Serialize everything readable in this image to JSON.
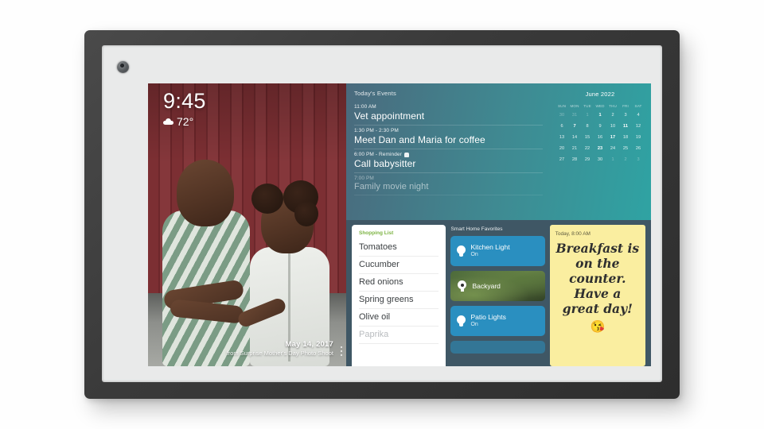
{
  "device": {
    "camera_icon": "camera-lens"
  },
  "photo": {
    "clock": {
      "time": "9:45",
      "temperature": "72°",
      "weather_icon": "cloud-icon"
    },
    "caption": {
      "date": "May 14, 2017",
      "subtitle": "from Surprise Mother's Day Photo Shoot"
    },
    "menu_icon": "more-vertical-icon"
  },
  "events": {
    "title": "Today's Events",
    "items": [
      {
        "time": "11:00 AM",
        "title": "Vet appointment",
        "has_reminder": false
      },
      {
        "time": "1:30 PM - 2:30 PM",
        "title": "Meet Dan and Maria for coffee",
        "has_reminder": false
      },
      {
        "time": "6:00 PM - Reminder",
        "title": "Call babysitter",
        "has_reminder": true
      },
      {
        "time": "7:00 PM",
        "title": "Family movie night",
        "has_reminder": false
      }
    ]
  },
  "calendar": {
    "month": "June 2022",
    "dow": [
      "SUN",
      "MON",
      "TUE",
      "WED",
      "THU",
      "FRI",
      "SAT"
    ],
    "weeks": [
      [
        {
          "n": "30",
          "style": "dim"
        },
        {
          "n": "31",
          "style": "dim"
        },
        {
          "n": "1",
          "style": "dim"
        },
        {
          "n": "1",
          "style": "today"
        },
        {
          "n": "2",
          "style": ""
        },
        {
          "n": "3",
          "style": ""
        },
        {
          "n": "4",
          "style": ""
        }
      ],
      [
        {
          "n": "6",
          "style": ""
        },
        {
          "n": "7",
          "style": "bold"
        },
        {
          "n": "8",
          "style": ""
        },
        {
          "n": "9",
          "style": ""
        },
        {
          "n": "10",
          "style": ""
        },
        {
          "n": "11",
          "style": "bold"
        },
        {
          "n": "12",
          "style": ""
        }
      ],
      [
        {
          "n": "13",
          "style": ""
        },
        {
          "n": "14",
          "style": ""
        },
        {
          "n": "15",
          "style": ""
        },
        {
          "n": "16",
          "style": ""
        },
        {
          "n": "17",
          "style": "bold"
        },
        {
          "n": "18",
          "style": ""
        },
        {
          "n": "19",
          "style": ""
        }
      ],
      [
        {
          "n": "20",
          "style": ""
        },
        {
          "n": "21",
          "style": ""
        },
        {
          "n": "22",
          "style": ""
        },
        {
          "n": "23",
          "style": "bold"
        },
        {
          "n": "24",
          "style": ""
        },
        {
          "n": "25",
          "style": ""
        },
        {
          "n": "26",
          "style": ""
        }
      ],
      [
        {
          "n": "27",
          "style": ""
        },
        {
          "n": "28",
          "style": ""
        },
        {
          "n": "29",
          "style": ""
        },
        {
          "n": "30",
          "style": ""
        },
        {
          "n": "1",
          "style": "dim"
        },
        {
          "n": "2",
          "style": "dim"
        },
        {
          "n": "3",
          "style": "dim"
        }
      ]
    ]
  },
  "shopping_list": {
    "title": "Shopping List",
    "items": [
      "Tomatoes",
      "Cucumber",
      "Red onions",
      "Spring greens",
      "Olive oil",
      "Paprika"
    ]
  },
  "smart_home": {
    "title": "Smart Home Favorites",
    "tiles": [
      {
        "name": "Kitchen Light",
        "state": "On",
        "icon": "lightbulb-icon",
        "kind": "light"
      },
      {
        "name": "Backyard",
        "state": "",
        "icon": "camera-icon",
        "kind": "camera"
      },
      {
        "name": "Patio Lights",
        "state": "On",
        "icon": "lightbulb-icon",
        "kind": "light"
      }
    ]
  },
  "note": {
    "meta": "Today, 8:00 AM",
    "body": "Breakfast is on the counter. Have a great day!",
    "emoji": "😘"
  },
  "colors": {
    "accent_blue": "#35c6f4",
    "tile_blue": "#2a8fc0",
    "list_green": "#7cb342",
    "note_yellow": "#faeea0",
    "screen_bg": "#3f5765"
  }
}
